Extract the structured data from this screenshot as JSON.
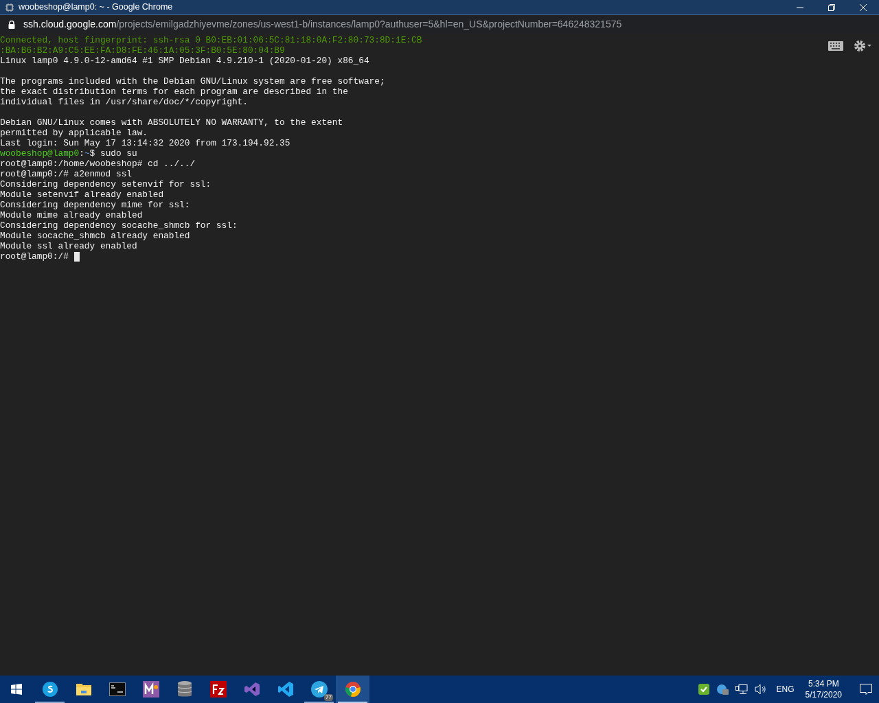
{
  "window": {
    "title": "woobeshop@lamp0: ~ - Google Chrome"
  },
  "address_bar": {
    "host": "ssh.cloud.google.com",
    "path": "/projects/emilgadzhiyevme/zones/us-west1-b/instances/lamp0?authuser=5&hl=en_US&projectNumber=646248321575"
  },
  "terminal": {
    "lines": [
      {
        "kind": "info",
        "text": "Connected, host fingerprint: ssh-rsa 0 B0:EB:01:06:5C:81:18:0A:F2:80:73:8D:1E:CB"
      },
      {
        "kind": "info",
        "text": ":BA:B6:B2:A9:C5:EE:FA:D8:FE:46:1A:05:3F:B0:5E:80:04:B9"
      },
      {
        "kind": "output",
        "text": "Linux lamp0 4.9.0-12-amd64 #1 SMP Debian 4.9.210-1 (2020-01-20) x86_64"
      },
      {
        "kind": "blank"
      },
      {
        "kind": "output",
        "text": "The programs included with the Debian GNU/Linux system are free software;"
      },
      {
        "kind": "output",
        "text": "the exact distribution terms for each program are described in the"
      },
      {
        "kind": "output",
        "text": "individual files in /usr/share/doc/*/copyright."
      },
      {
        "kind": "blank"
      },
      {
        "kind": "output",
        "text": "Debian GNU/Linux comes with ABSOLUTELY NO WARRANTY, to the extent"
      },
      {
        "kind": "output",
        "text": "permitted by applicable law."
      },
      {
        "kind": "output",
        "text": "Last login: Sun May 17 13:14:32 2020 from 173.194.92.35"
      },
      {
        "kind": "prompt",
        "user": "woobeshop@lamp0",
        "separator": ":",
        "path": "~",
        "symbol": "$",
        "command": "sudo su"
      },
      {
        "kind": "output",
        "text": "root@lamp0:/home/woobeshop# cd ../../"
      },
      {
        "kind": "output",
        "text": "root@lamp0:/# a2enmod ssl"
      },
      {
        "kind": "output",
        "text": "Considering dependency setenvif for ssl:"
      },
      {
        "kind": "output",
        "text": "Module setenvif already enabled"
      },
      {
        "kind": "output",
        "text": "Considering dependency mime for ssl:"
      },
      {
        "kind": "output",
        "text": "Module mime already enabled"
      },
      {
        "kind": "output",
        "text": "Considering dependency socache_shmcb for ssl:"
      },
      {
        "kind": "output",
        "text": "Module socache_shmcb already enabled"
      },
      {
        "kind": "output",
        "text": "Module ssl already enabled"
      },
      {
        "kind": "cursor",
        "text": "root@lamp0:/#"
      }
    ]
  },
  "taskbar": {
    "apps": [
      {
        "kind": "skype",
        "running": true,
        "selected": false
      },
      {
        "kind": "folder",
        "running": false,
        "selected": false
      },
      {
        "kind": "console",
        "running": false,
        "selected": false
      },
      {
        "kind": "mathtype",
        "running": false,
        "selected": false
      },
      {
        "kind": "database",
        "running": false,
        "selected": false
      },
      {
        "kind": "filezilla",
        "running": false,
        "selected": false
      },
      {
        "kind": "visualstudio",
        "running": false,
        "selected": false
      },
      {
        "kind": "vscode",
        "running": false,
        "selected": false
      },
      {
        "kind": "telegram",
        "running": true,
        "selected": false,
        "badge": "77"
      },
      {
        "kind": "chrome",
        "running": true,
        "selected": true
      }
    ],
    "tray": {
      "language": "ENG",
      "time": "5:34 PM",
      "date": "5/17/2020"
    }
  }
}
